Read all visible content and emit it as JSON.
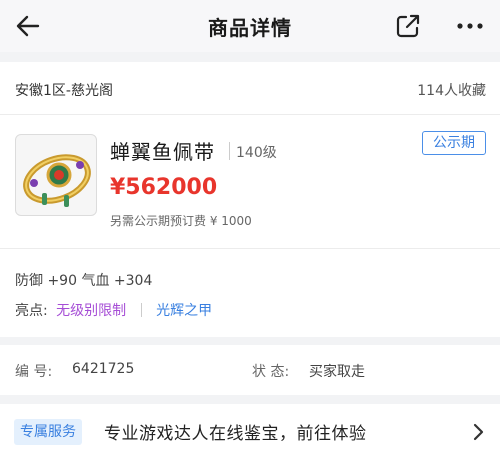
{
  "header": {
    "title": "商品详情"
  },
  "listing": {
    "server": "安徽1区-慈光阁",
    "favorites": "114人收藏",
    "item_name": "蝉翼鱼佩带",
    "level": "140级",
    "status_badge": "公示期",
    "price": "¥562000",
    "deposit_note": "另需公示期预订费 ¥ 1000",
    "image": "jade-belt-item-icon",
    "stats": "防御 +90 气血 +304",
    "highlights_label": "亮点:",
    "highlight_tags": [
      "无级别限制",
      "光辉之甲"
    ]
  },
  "info": {
    "id_label": "编  号:",
    "id_value": "6421725",
    "status_label": "状  态:",
    "status_value": "买家取走"
  },
  "service": {
    "badge": "专属服务",
    "text": "专业游戏达人在线鉴宝，前往体验"
  },
  "colors": {
    "price": "#e8352c",
    "accent_blue": "#3a80e0",
    "accent_purple": "#a64ed6",
    "background": "#f2f3f5"
  }
}
